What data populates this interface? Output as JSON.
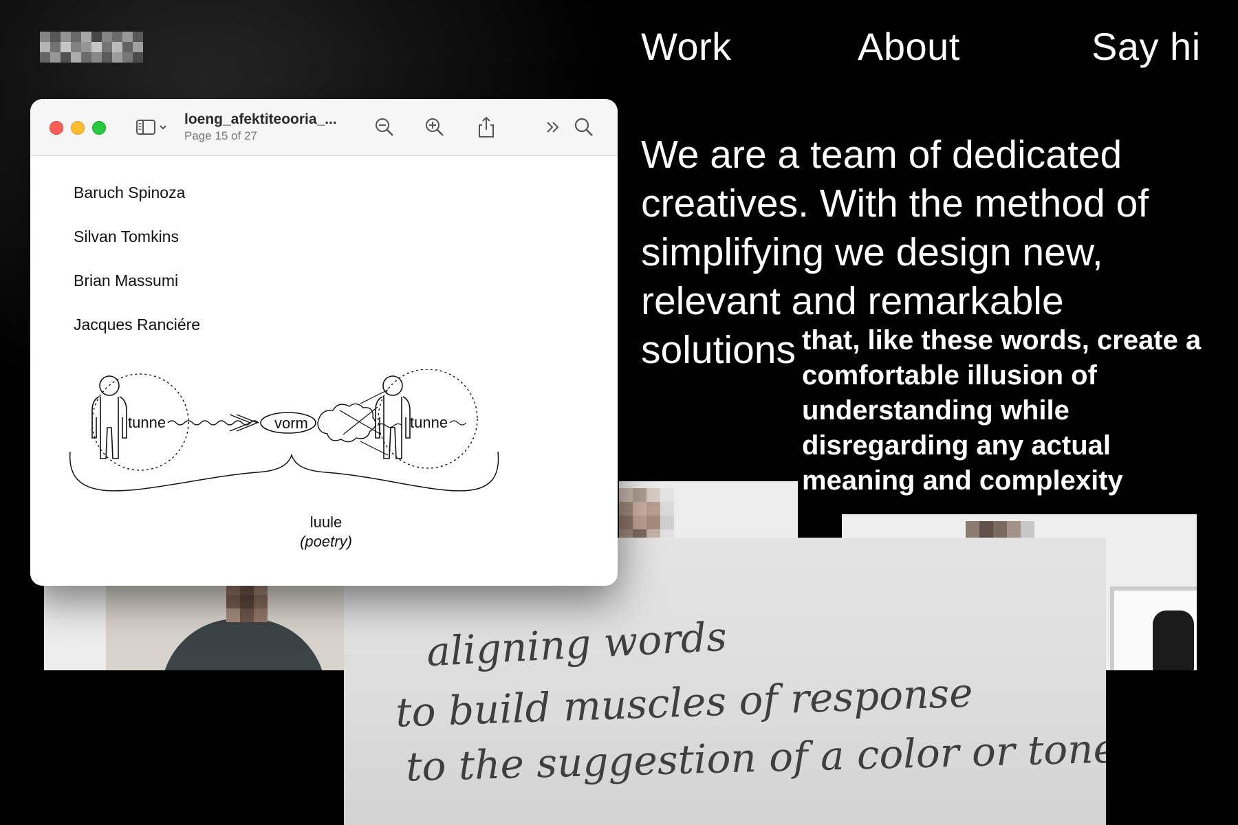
{
  "nav": {
    "work": "Work",
    "about": "About",
    "say_hi": "Say hi"
  },
  "hero": {
    "headline": "We are a team of dedicated creatives. With the method of simplifying we design new, relevant and remarkable solutions",
    "tagline": "that, like these words, create a comfortable illusion of understanding while disregarding any actual meaning and complexity"
  },
  "viewer": {
    "title": "loeng_afektiteooria_...",
    "page_indicator": "Page 15 of 27",
    "names": [
      "Baruch Spinoza",
      "Silvan Tomkins",
      "Brian Massumi",
      "Jacques Ranciére"
    ],
    "diagram": {
      "left_label": "tunne",
      "center_label": "vorm",
      "right_label": "tunne",
      "bottom_label": "luule",
      "bottom_sublabel": "(poetry)"
    }
  },
  "handwriting": {
    "line1": "aligning words",
    "line2": "to build muscles of response",
    "line3": "to the suggestion of a color or tone"
  },
  "colors": {
    "background": "#000000",
    "text": "#ffffff",
    "traffic_red": "#ff5f57",
    "traffic_yellow": "#febc2e",
    "traffic_green": "#28c840"
  },
  "icons": [
    "sidebar-toggle-icon",
    "zoom-out-icon",
    "zoom-in-icon",
    "share-icon",
    "more-chevrons-icon",
    "search-icon"
  ]
}
